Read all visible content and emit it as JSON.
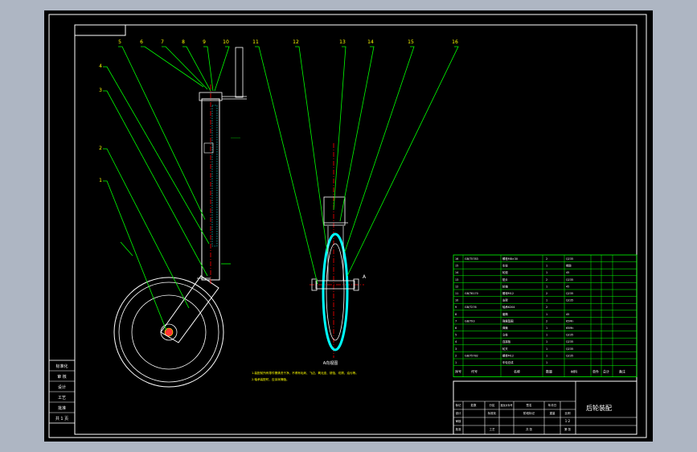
{
  "drawing": {
    "title": "后轮装配",
    "balloon_numbers": [
      "1",
      "2",
      "3",
      "4",
      "5",
      "6",
      "7",
      "8",
      "9",
      "10",
      "11",
      "12",
      "13",
      "14",
      "15",
      "16"
    ],
    "section_label": "A",
    "view_caption": "A向视图",
    "note_label": "技术要求",
    "technical_notes": [
      "1.装配前所有零件需清洗干净，不得有毛刺、飞边、氧化皮、锈蚀、切屑、油污等。",
      "2.轴承装配时，应涂润滑脂。"
    ]
  },
  "side_stamp": [
    "标准化",
    "审 核",
    "设计",
    "工艺",
    "批准",
    "共 1 页"
  ],
  "bom": {
    "header": [
      "序号",
      "代号",
      "名称",
      "数量",
      "材料",
      "单件",
      "总计",
      "备注"
    ],
    "rows": [
      {
        "no": "16",
        "code": "GB/T5783",
        "name": "螺栓M8×30",
        "qty": "2",
        "mat": "Q235"
      },
      {
        "no": "15",
        "code": "",
        "name": "车轮",
        "qty": "1",
        "mat": "橡胶"
      },
      {
        "no": "14",
        "code": "",
        "name": "轮毂",
        "qty": "1",
        "mat": "45"
      },
      {
        "no": "13",
        "code": "",
        "name": "垫片",
        "qty": "2",
        "mat": "Q235"
      },
      {
        "no": "12",
        "code": "",
        "name": "轮轴",
        "qty": "1",
        "mat": "45"
      },
      {
        "no": "11",
        "code": "GB/T6170",
        "name": "螺母M12",
        "qty": "2",
        "mat": "Q235"
      },
      {
        "no": "10",
        "code": "",
        "name": "支架",
        "qty": "1",
        "mat": "Q235"
      },
      {
        "no": "9",
        "code": "GB/T276",
        "name": "轴承6204",
        "qty": "2",
        "mat": ""
      },
      {
        "no": "8",
        "code": "",
        "name": "套筒",
        "qty": "1",
        "mat": "45"
      },
      {
        "no": "7",
        "code": "GB/T93",
        "name": "弹簧垫圈",
        "qty": "2",
        "mat": "65Mn"
      },
      {
        "no": "6",
        "code": "",
        "name": "弹簧",
        "qty": "1",
        "mat": "65Mn"
      },
      {
        "no": "5",
        "code": "",
        "name": "立柱",
        "qty": "1",
        "mat": "Q235"
      },
      {
        "no": "4",
        "code": "",
        "name": "连接板",
        "qty": "1",
        "mat": "Q235"
      },
      {
        "no": "3",
        "code": "",
        "name": "轮叉",
        "qty": "1",
        "mat": "Q235"
      },
      {
        "no": "2",
        "code": "GB/T5782",
        "name": "螺栓M12",
        "qty": "1",
        "mat": "Q235"
      },
      {
        "no": "1",
        "code": "",
        "name": "车轮总成",
        "qty": "1",
        "mat": ""
      }
    ]
  },
  "title_block": {
    "title": "后轮装配",
    "labels": [
      "标记",
      "处数",
      "分区",
      "更改文件号",
      "签名",
      "年月日",
      "设计",
      "标准化",
      "阶段标记",
      "重量",
      "比例",
      "审核",
      "工艺",
      "批准",
      "共 张",
      "第 张"
    ],
    "scale": "1:2"
  },
  "colors": {
    "sheet": "#000000",
    "border": "#ffffff",
    "leader": "#00ff00",
    "centerline": "#ff0000",
    "section": "#00ffff",
    "frame_bg": "#aeb6c3"
  }
}
